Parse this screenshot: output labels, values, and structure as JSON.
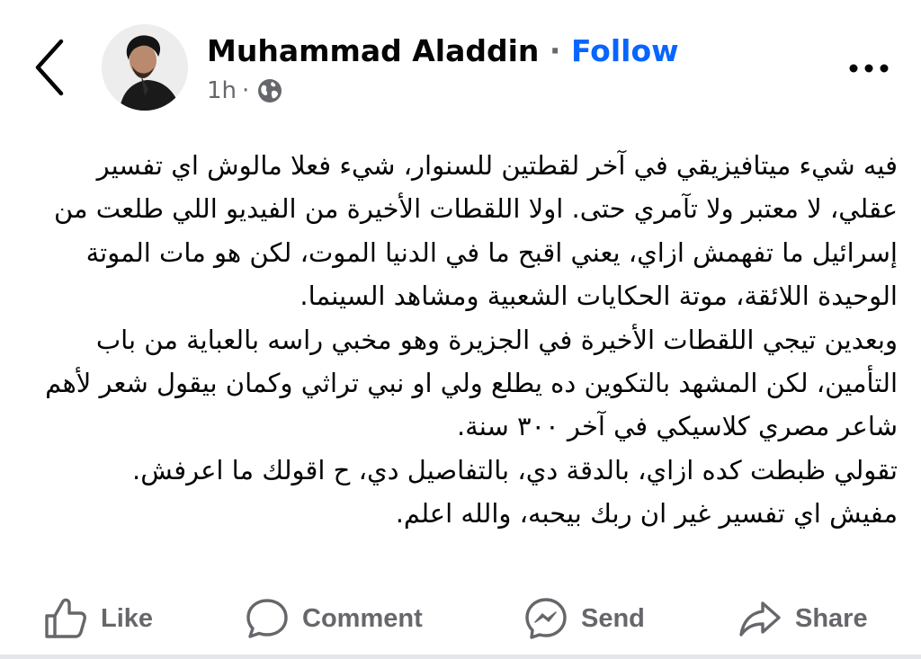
{
  "post": {
    "author_name": "Muhammad Aladdin",
    "separator": "·",
    "follow_label": "Follow",
    "time": "1h",
    "meta_separator": "·",
    "privacy_icon": "globe-icon",
    "paragraphs": [
      "فيه شيء ميتافيزيقي في آخر لقطتين للسنوار، شيء فعلا مالوش اي تفسير عقلي، لا معتبر ولا تآمري حتى. اولا اللقطات الأخيرة من الفيديو اللي طلعت من إسرائيل ما تفهمش ازاي، يعني اقبح ما في الدنيا الموت، لكن هو مات الموتة الوحيدة اللائقة، موتة الحكايات الشعبية ومشاهد السينما.",
      "وبعدين تيجي اللقطات الأخيرة في الجزيرة وهو مخبي راسه بالعباية من باب التأمين، لكن المشهد بالتكوين ده يطلع ولي او نبي تراثي وكمان بيقول شعر لأهم شاعر مصري كلاسيكي في آخر ٣٠٠ سنة.",
      "تقولي ظبطت كده ازاي، بالدقة دي، بالتفاصيل دي، ح اقولك ما اعرفش.",
      "مفيش اي تفسير غير ان ربك بيحبه، والله اعلم."
    ]
  },
  "actions": {
    "like": "Like",
    "comment": "Comment",
    "send": "Send",
    "share": "Share"
  },
  "colors": {
    "follow": "#0866ff",
    "muted": "#65676b",
    "text": "#050505"
  },
  "icons": {
    "back": "chevron-left-icon",
    "more": "more-dots-icon",
    "like": "thumbs-up-icon",
    "comment": "comment-bubble-icon",
    "send": "messenger-icon",
    "share": "share-arrow-icon"
  }
}
